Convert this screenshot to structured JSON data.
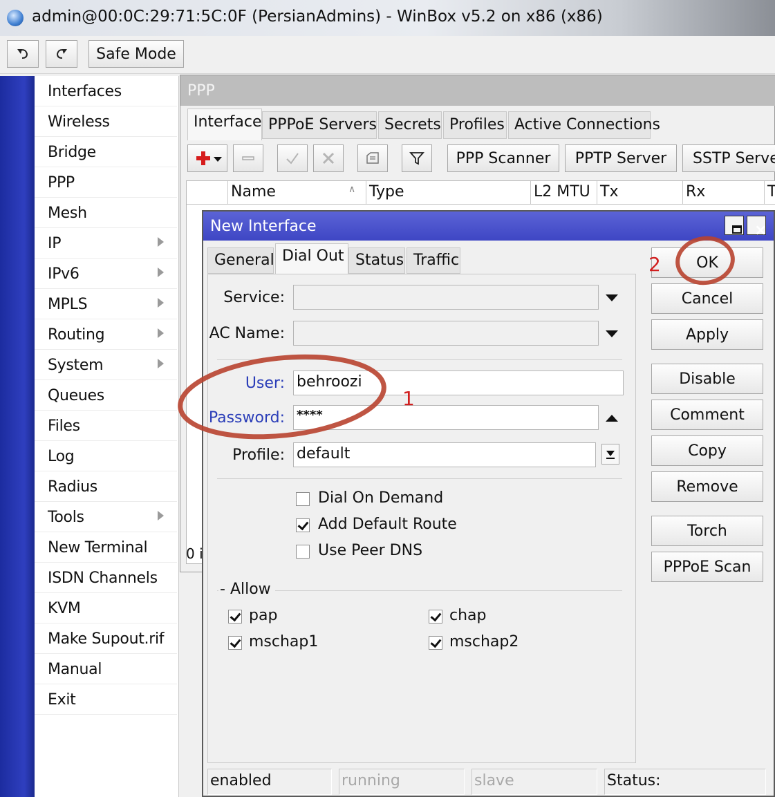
{
  "window": {
    "title": "admin@00:0C:29:71:5C:0F (PersianAdmins) - WinBox v5.2 on x86 (x86)"
  },
  "toolbar": {
    "undo_icon": "undo-icon",
    "redo_icon": "redo-icon",
    "safe_mode": "Safe Mode"
  },
  "sidebar": {
    "items": [
      {
        "label": "Interfaces"
      },
      {
        "label": "Wireless"
      },
      {
        "label": "Bridge"
      },
      {
        "label": "PPP"
      },
      {
        "label": "Mesh"
      },
      {
        "label": "IP"
      },
      {
        "label": "IPv6"
      },
      {
        "label": "MPLS"
      },
      {
        "label": "Routing"
      },
      {
        "label": "System"
      },
      {
        "label": "Queues"
      },
      {
        "label": "Files"
      },
      {
        "label": "Log"
      },
      {
        "label": "Radius"
      },
      {
        "label": "Tools"
      },
      {
        "label": "New Terminal"
      },
      {
        "label": "ISDN Channels"
      },
      {
        "label": "KVM"
      },
      {
        "label": "Make Supout.rif"
      },
      {
        "label": "Manual"
      },
      {
        "label": "Exit"
      }
    ]
  },
  "ppp": {
    "title": "PPP",
    "tabs": [
      "Interface",
      "PPPoE Servers",
      "Secrets",
      "Profiles",
      "Active Connections"
    ],
    "buttons": {
      "scanner": "PPP Scanner",
      "pptp": "PPTP Server",
      "sstp": "SSTP Serve"
    },
    "columns": [
      "Name",
      "Type",
      "L2 MTU",
      "Tx",
      "Rx",
      "T"
    ],
    "count": "0 i"
  },
  "dialog": {
    "title": "New Interface",
    "tabs": [
      "General",
      "Dial Out",
      "Status",
      "Traffic"
    ],
    "fields": {
      "service_label": "Service:",
      "service_value": "",
      "ac_name_label": "AC Name:",
      "ac_name_value": "",
      "user_label": "User:",
      "user_value": "behroozi",
      "password_label": "Password:",
      "password_value": "****",
      "profile_label": "Profile:",
      "profile_value": "default"
    },
    "options": [
      {
        "label": "Dial On Demand",
        "checked": false
      },
      {
        "label": "Add Default Route",
        "checked": true
      },
      {
        "label": "Use Peer DNS",
        "checked": false
      }
    ],
    "allow": {
      "label": "Allow",
      "items": [
        {
          "label": "pap",
          "checked": true
        },
        {
          "label": "chap",
          "checked": true
        },
        {
          "label": "mschap1",
          "checked": true
        },
        {
          "label": "mschap2",
          "checked": true
        }
      ]
    },
    "buttons": [
      "OK",
      "Cancel",
      "Apply",
      "Disable",
      "Comment",
      "Copy",
      "Remove",
      "Torch",
      "PPPoE Scan"
    ],
    "status_bar": [
      "enabled",
      "running",
      "slave",
      "Status:"
    ],
    "annotations": {
      "one": "1",
      "two": "2"
    }
  },
  "colors": {
    "sidebar_stripe": "#2f3fbf",
    "dialog_title": "#4a52cc",
    "annotation": "#c0392b"
  }
}
